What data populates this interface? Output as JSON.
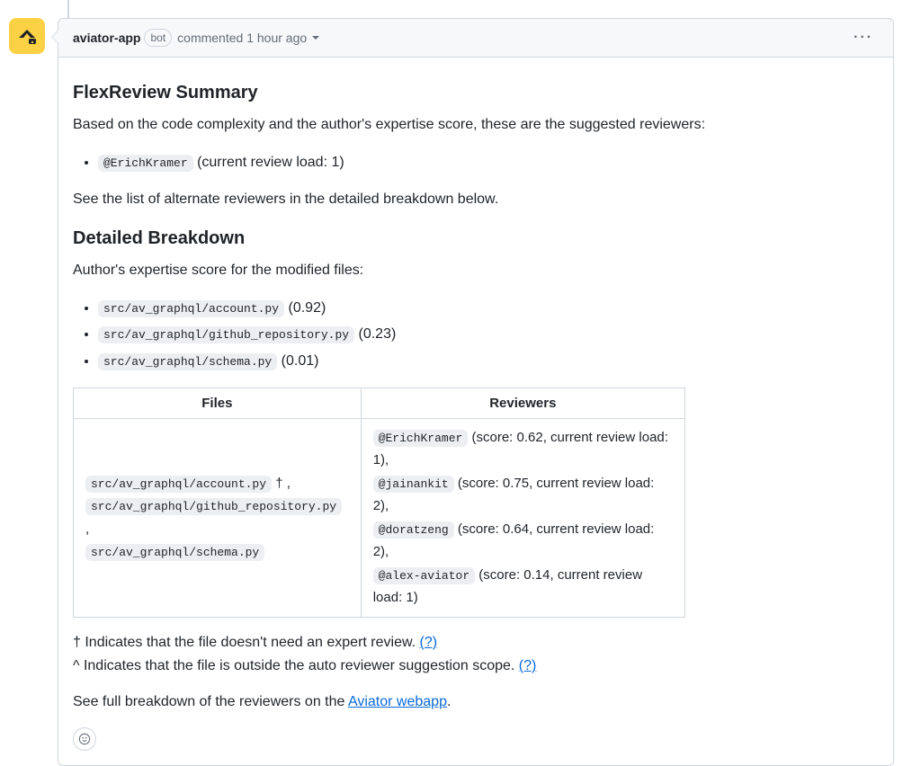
{
  "header": {
    "author": "aviator-app",
    "bot_label": "bot",
    "action": "commented",
    "time": "1 hour ago"
  },
  "summary": {
    "heading": "FlexReview Summary",
    "intro": "Based on the code complexity and the author's expertise score, these are the suggested reviewers:",
    "suggested_reviewer": "@ErichKramer",
    "suggested_reviewer_note": " (current review load: 1)",
    "alt_note": "See the list of alternate reviewers in the detailed breakdown below."
  },
  "breakdown": {
    "heading": "Detailed Breakdown",
    "intro": "Author's expertise score for the modified files:",
    "files": [
      {
        "path": "src/av_graphql/account.py",
        "score": " (0.92)"
      },
      {
        "path": "src/av_graphql/github_repository.py",
        "score": " (0.23)"
      },
      {
        "path": "src/av_graphql/schema.py",
        "score": " (0.01)"
      }
    ],
    "table": {
      "col_files": "Files",
      "col_reviewers": "Reviewers",
      "cell_files": [
        {
          "path": "src/av_graphql/account.py",
          "suffix": " † ,"
        },
        {
          "path": "src/av_graphql/github_repository.py",
          "suffix": " ,"
        },
        {
          "path": "src/av_graphql/schema.py",
          "suffix": ""
        }
      ],
      "cell_reviewers": [
        {
          "handle": "@ErichKramer",
          "meta": " (score: 0.62, current review load: 1),"
        },
        {
          "handle": "@jainankit",
          "meta": " (score: 0.75, current review load: 2),"
        },
        {
          "handle": "@doratzeng",
          "meta": " (score: 0.64, current review load: 2),"
        },
        {
          "handle": "@alex-aviator",
          "meta": " (score: 0.14, current review load: 1)"
        }
      ]
    }
  },
  "footnotes": {
    "dagger": "† Indicates that the file doesn't need an expert review. ",
    "caret": "^ Indicates that the file is outside the auto reviewer suggestion scope. ",
    "help": "(?)",
    "see_full_prefix": "See full breakdown of the reviewers on the ",
    "see_full_link": "Aviator webapp",
    "see_full_suffix": "."
  }
}
